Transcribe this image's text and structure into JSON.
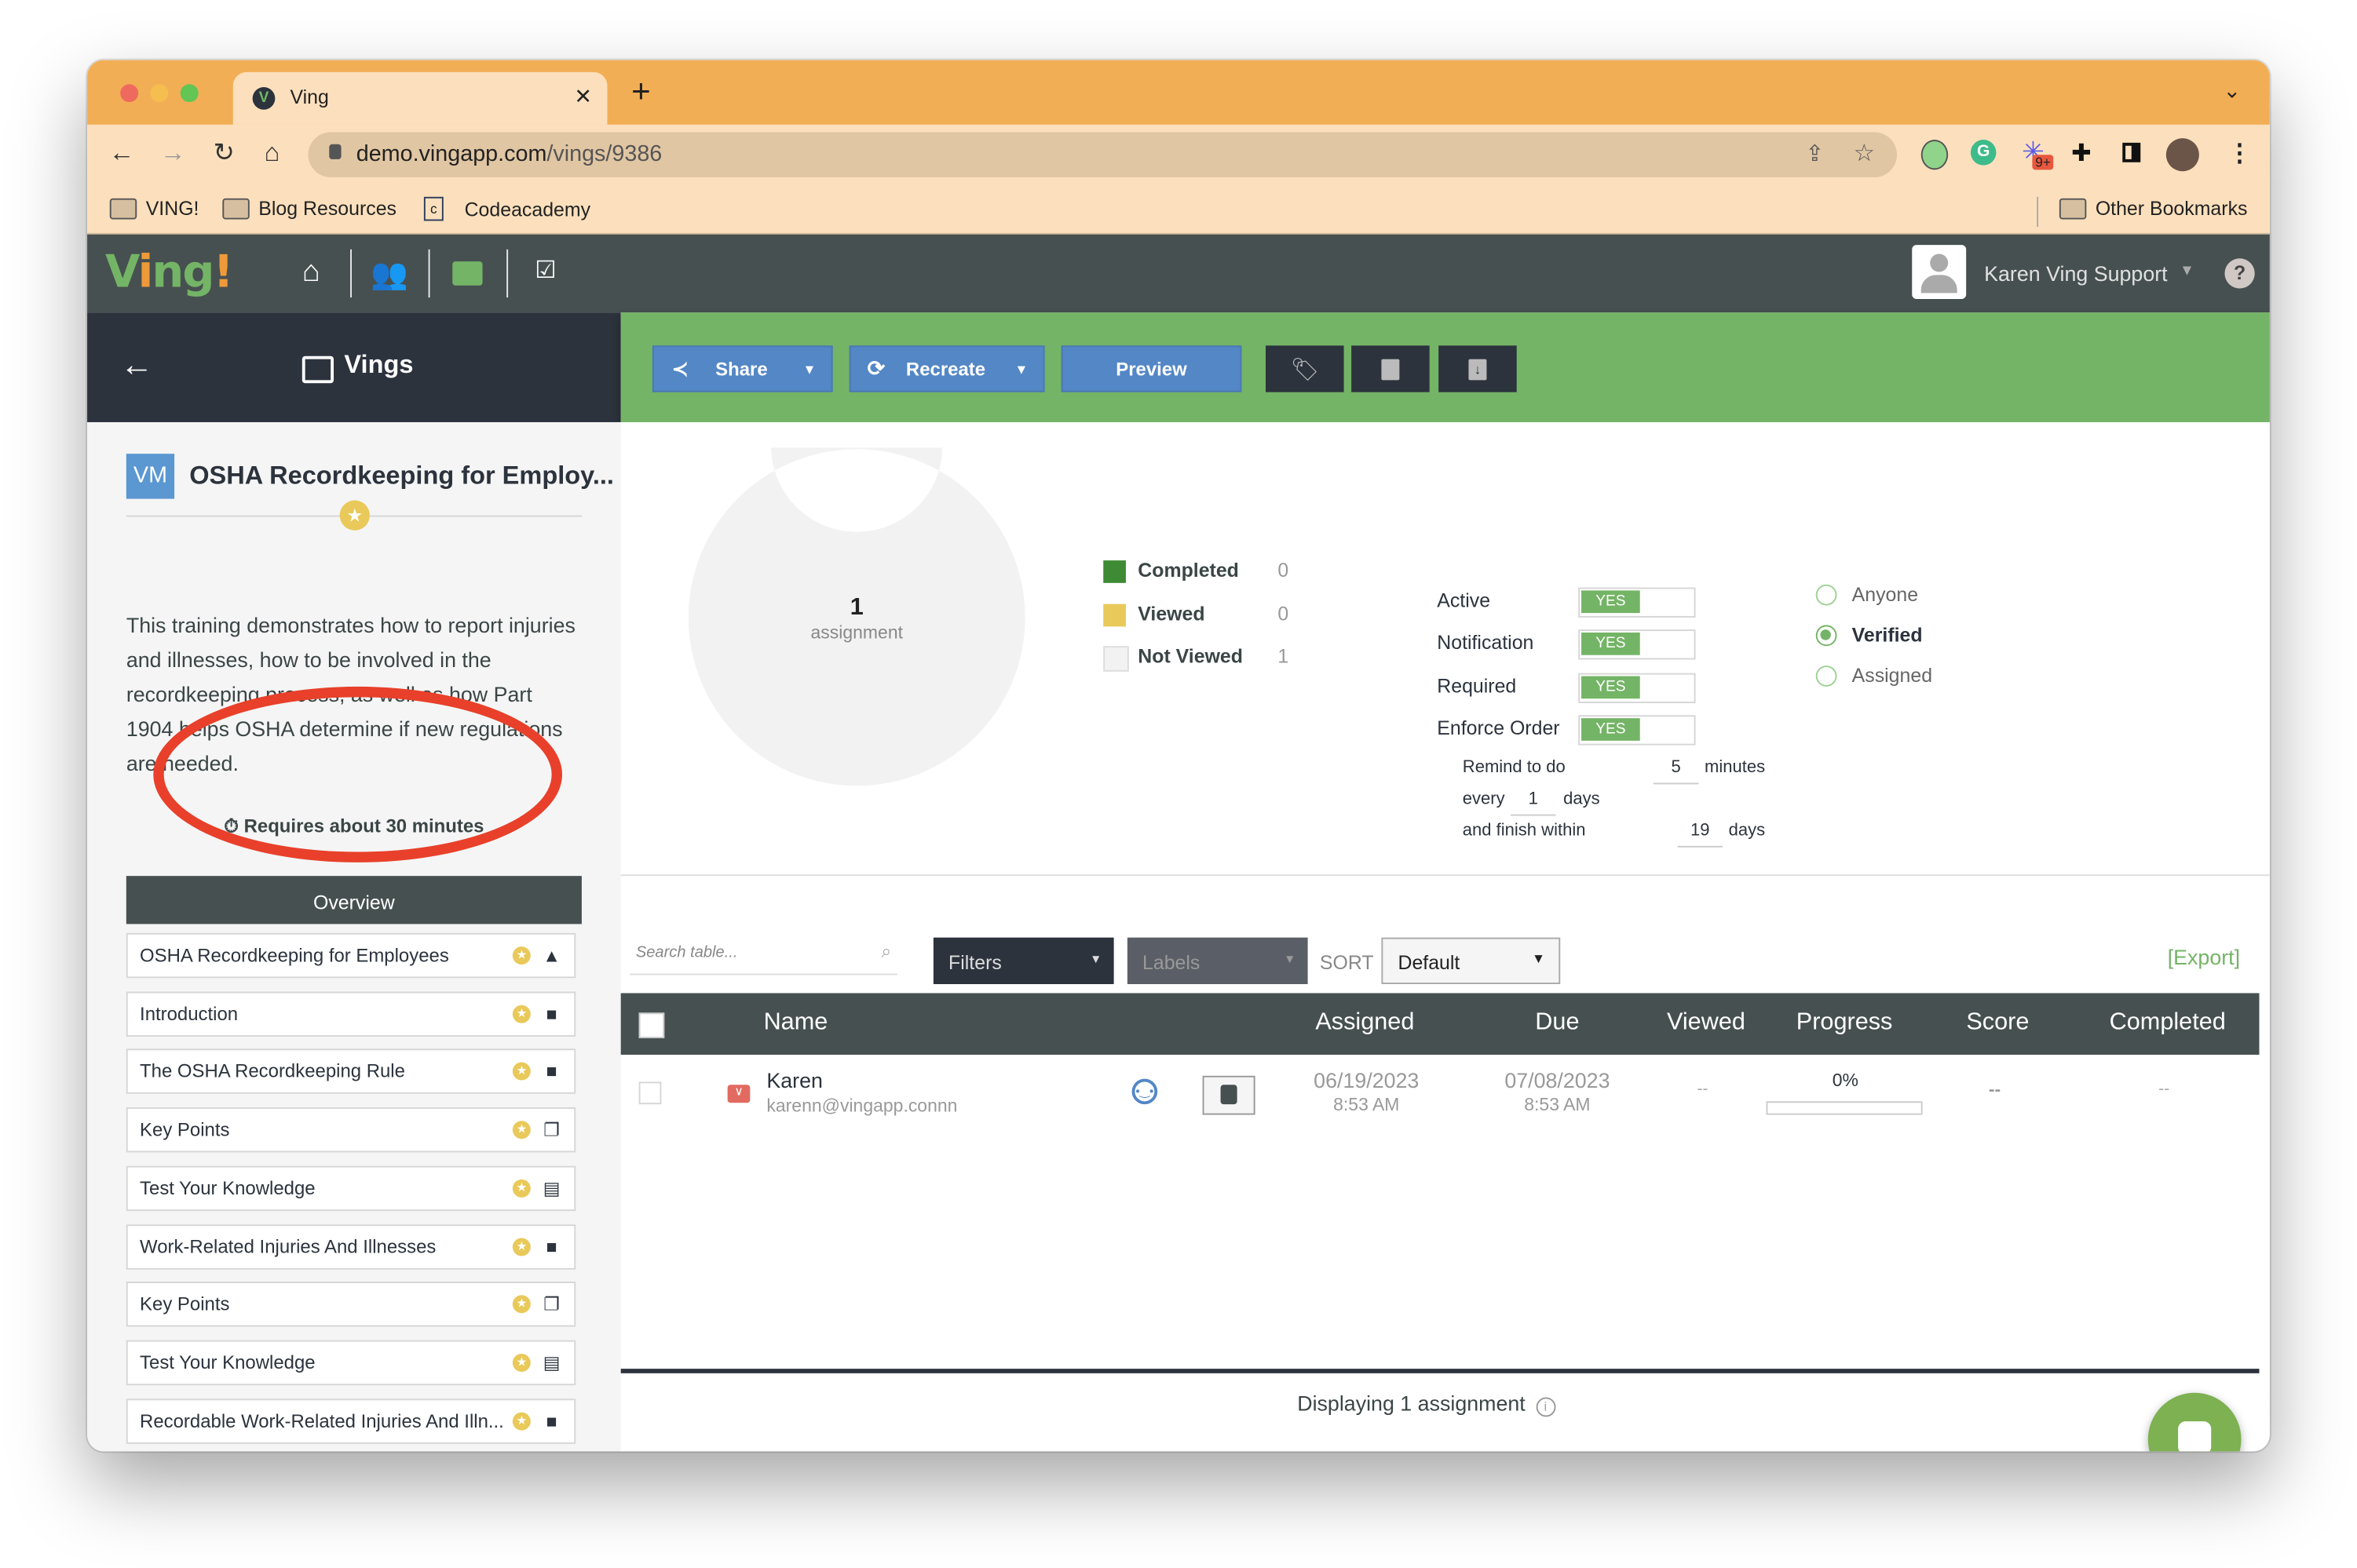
{
  "browser": {
    "tab_title": "Ving",
    "url_domain": "demo.vingapp.com",
    "url_path": "/vings/9386",
    "bookmarks": [
      "VING!",
      "Blog Resources",
      "Codeacademy"
    ],
    "other_bookmarks": "Other Bookmarks",
    "extension_badge": "9+"
  },
  "app": {
    "logo_text": "Ving!",
    "user_name": "Karen Ving Support",
    "help": "?",
    "nav_icons": [
      "home-icon",
      "users-icon",
      "vings-icon",
      "tasks-icon"
    ]
  },
  "subheader": {
    "title": "Vings",
    "buttons": {
      "share": "Share",
      "recreate": "Recreate",
      "preview": "Preview"
    }
  },
  "ving": {
    "badge": "VM",
    "title": "OSHA Recordkeeping for Employ...",
    "description": "This training demonstrates how to report injuries and illnesses, how to be involved in the recordkeeping process, as well as how Part 1904 helps OSHA determine if new regulations are needed.",
    "duration": "Requires about 30 minutes",
    "overview_label": "Overview",
    "items": [
      {
        "label": "OSHA Recordkeeping for Employees",
        "type": "image-icon"
      },
      {
        "label": "Introduction",
        "type": "video-icon"
      },
      {
        "label": "The OSHA Recordkeeping Rule",
        "type": "video-icon"
      },
      {
        "label": "Key Points",
        "type": "copy-icon"
      },
      {
        "label": "Test Your Knowledge",
        "type": "clipboard-icon"
      },
      {
        "label": "Work-Related Injuries And Illnesses",
        "type": "video-icon"
      },
      {
        "label": "Key Points",
        "type": "copy-icon"
      },
      {
        "label": "Test Your Knowledge",
        "type": "clipboard-icon"
      },
      {
        "label": "Recordable Work-Related Injuries And Illn...",
        "type": "video-icon"
      },
      {
        "label": "",
        "type": "copy-icon"
      }
    ]
  },
  "chart_data": {
    "type": "pie",
    "title": "",
    "center_value": "1",
    "center_label": "assignment",
    "categories": [
      "Completed",
      "Viewed",
      "Not Viewed"
    ],
    "values": [
      0,
      0,
      1
    ],
    "colors": [
      "#3e8a35",
      "#e9c95a",
      "#f2f2f2"
    ],
    "legend": "right"
  },
  "settings": {
    "toggles": [
      {
        "label": "Active",
        "value": "YES"
      },
      {
        "label": "Notification",
        "value": "YES"
      },
      {
        "label": "Required",
        "value": "YES"
      },
      {
        "label": "Enforce Order",
        "value": "YES"
      }
    ],
    "remind_prefix": "Remind to do",
    "remind_value": "5",
    "remind_unit": "minutes",
    "every_prefix": "every",
    "every_value": "1",
    "every_unit": "days",
    "finish_prefix": "and finish within",
    "finish_value": "19",
    "finish_unit": "days"
  },
  "visibility": {
    "options": [
      "Anyone",
      "Verified",
      "Assigned"
    ],
    "selected": "Verified"
  },
  "table_controls": {
    "search_placeholder": "Search table...",
    "filters": "Filters",
    "labels": "Labels",
    "sort_label": "SORT",
    "sort_value": "Default",
    "export": "[Export]"
  },
  "table": {
    "columns": [
      "Name",
      "Assigned",
      "Due",
      "Viewed",
      "Progress",
      "Score",
      "Completed"
    ],
    "rows": [
      {
        "name": "Karen",
        "email": "karenn@vingapp.connn",
        "assigned_date": "06/19/2023",
        "assigned_time": "8:53 AM",
        "due_date": "07/08/2023",
        "due_time": "8:53 AM",
        "viewed": "--",
        "progress": "0%",
        "progress_value": 0,
        "score": "--",
        "completed": "--"
      }
    ],
    "footer": "Displaying 1 assignment"
  },
  "colors": {
    "brand_green": "#74b466",
    "dark": "#2c333d",
    "header": "#475050",
    "blue": "#5387c6",
    "browser_orange": "#f2ae55",
    "annotation_red": "#e8402a"
  }
}
